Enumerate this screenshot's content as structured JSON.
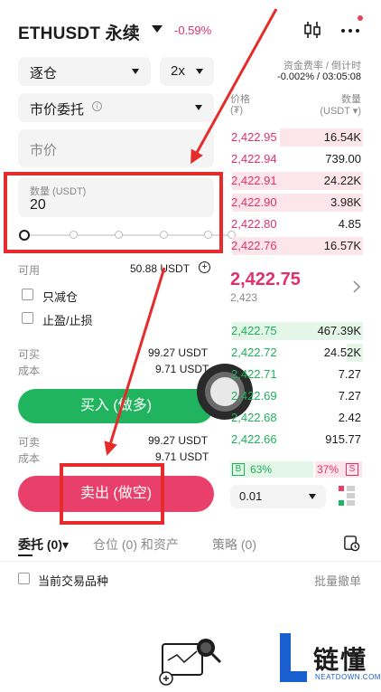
{
  "header": {
    "symbol": "ETHUSDT 永续",
    "change": "-0.59%",
    "chart_icon": "candlestick-chart-icon",
    "more_icon": "more-dots-icon"
  },
  "form": {
    "margin_mode": "逐仓",
    "leverage": "2x",
    "order_type": "市价委托",
    "order_type_info_icon": "info-icon",
    "price_placeholder": "市价",
    "quantity_label": "数量 (USDT)",
    "quantity_value": "20",
    "available_label": "可用",
    "available_value": "50.88 USDT",
    "reduce_only_label": "只减仓",
    "tp_sl_label": "止盈/止损",
    "buy_label": "可买",
    "buy_value": "99.27 USDT",
    "buy_cost_label": "成本",
    "buy_cost_value": "9.71 USDT",
    "buy_button": "买入 (做多)",
    "sell_label": "可卖",
    "sell_value": "99.27 USDT",
    "sell_cost_label": "成本",
    "sell_cost_value": "9.71 USDT",
    "sell_button": "卖出 (做空)"
  },
  "orderbook": {
    "funding_label": "资金费率 / 倒计时",
    "funding_value": "-0.002% / 03:05:08",
    "price_header": "价格",
    "price_unit": "(₮)",
    "qty_header": "数量",
    "qty_unit": "(USDT ▾)",
    "asks": [
      {
        "price": "2,422.95",
        "qty": "16.54K",
        "depth": 0.62
      },
      {
        "price": "2,422.94",
        "qty": "739.00",
        "depth": 0.0
      },
      {
        "price": "2,422.91",
        "qty": "24.22K",
        "depth": 0.98
      },
      {
        "price": "2,422.90",
        "qty": "3.98K",
        "depth": 0.98
      },
      {
        "price": "2,422.80",
        "qty": "4.85",
        "depth": 0.0
      },
      {
        "price": "2,422.76",
        "qty": "16.57K",
        "depth": 0.98
      }
    ],
    "last_price": "2,422.75",
    "mark_price": "2,423",
    "bids": [
      {
        "price": "2,422.75",
        "qty": "467.39K",
        "depth": 0.98
      },
      {
        "price": "2,422.72",
        "qty": "24.52K",
        "depth": 0.12
      },
      {
        "price": "2,422.71",
        "qty": "7.27",
        "depth": 0.0
      },
      {
        "price": "2,422.69",
        "qty": "7.27",
        "depth": 0.0
      },
      {
        "price": "2,422.68",
        "qty": "2.42",
        "depth": 0.0
      },
      {
        "price": "2,422.66",
        "qty": "915.77",
        "depth": 0.0
      }
    ],
    "buy_ratio_badge": "B",
    "buy_ratio": "63%",
    "sell_ratio": "37%",
    "sell_ratio_badge": "S",
    "precision": "0.01"
  },
  "tabs": {
    "orders": "委托 (0)▾",
    "positions": "仓位 (0) 和资产",
    "strategy": "策略 (0)"
  },
  "list_controls": {
    "current_symbol_label": "当前交易品种",
    "batch_cancel_label": "批量撤单"
  },
  "watermark": {
    "text": "链懂",
    "domain": "NEATDOWN.COM"
  },
  "colors": {
    "buy_green": "#21b45e",
    "sell_red": "#e8406a",
    "annotation_red": "#e62b2b"
  }
}
